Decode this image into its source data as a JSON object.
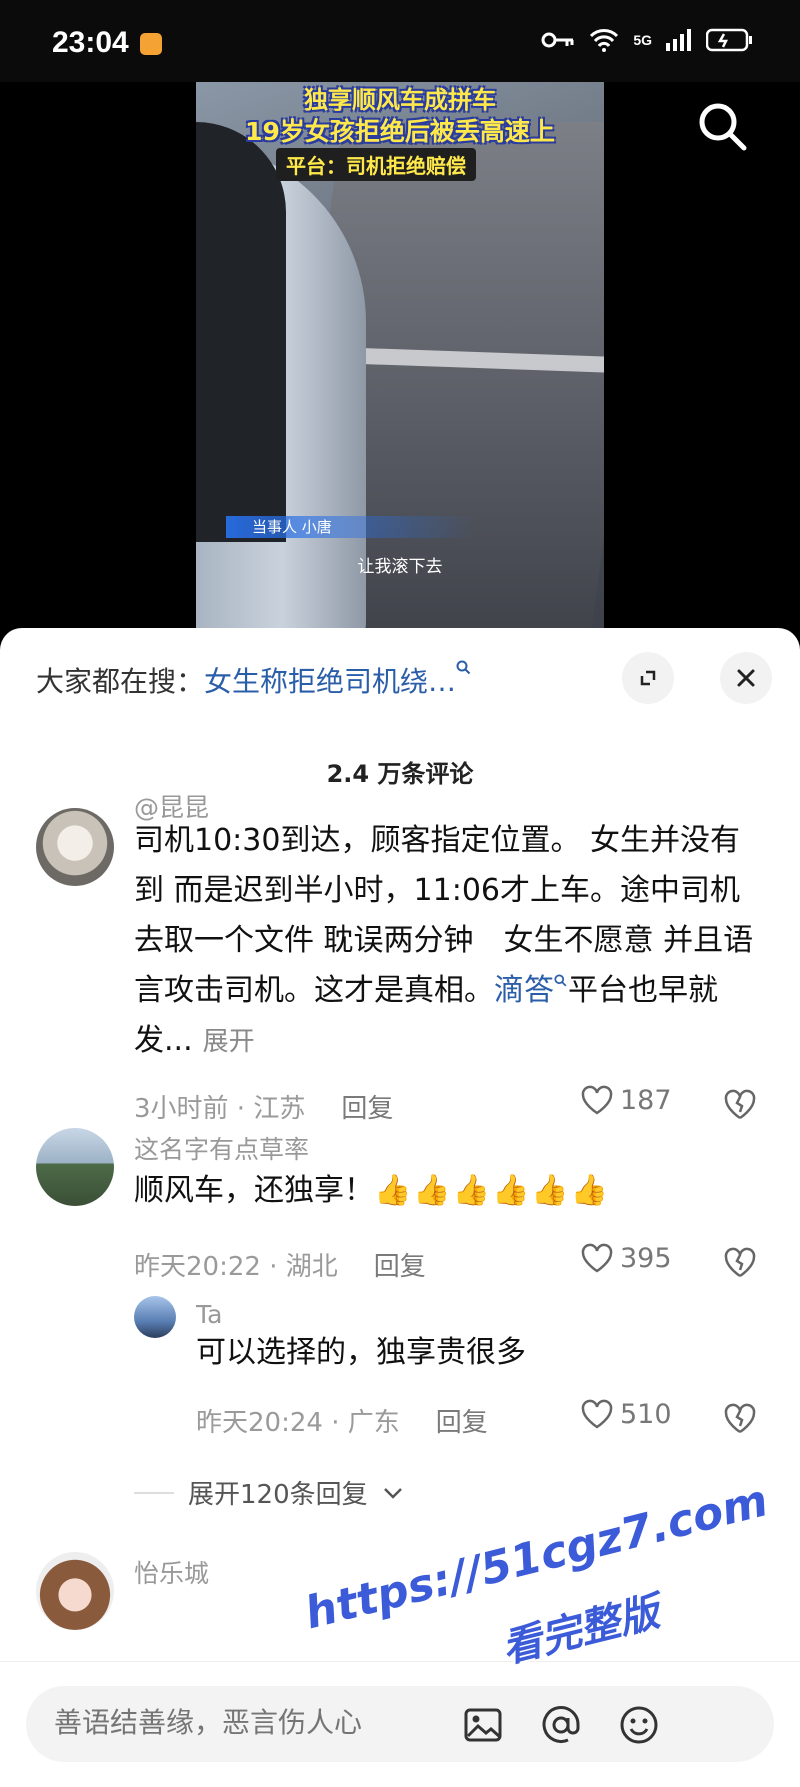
{
  "status_bar": {
    "time": "23:04",
    "network": "5G"
  },
  "video": {
    "caption_line1": "独享顺风车成拼车",
    "caption_line2": "19岁女孩拒绝后被丢高速上",
    "caption_line3": "平台：司机拒绝赔偿",
    "name_tag": "当事人 小唐",
    "subtitle": "让我滚下去"
  },
  "panel": {
    "hot_search_prefix": "大家都在搜：",
    "hot_search_query": "女生称拒绝司机绕…",
    "comment_count": "2.4 万条评论"
  },
  "comments": [
    {
      "username": "@昆昆",
      "text": "司机10:30到达，顾客指定位置。 女生并没有到 而是迟到半小时，11:06才上车。途中司机去取一个文件 耽误两分钟　女生不愿意 并且语言攻击司机。这才是真相。",
      "link_text": "滴答",
      "tail_text": "平台也早就发...",
      "expand_label": "展开",
      "time": "3小时前 · 江苏",
      "reply_label": "回复",
      "likes": "187"
    },
    {
      "username": "这名字有点草率",
      "text": "顺风车，还独享！",
      "emoji": "👍👍👍👍👍👍",
      "time": "昨天20:22 · 湖北",
      "reply_label": "回复",
      "likes": "395"
    },
    {
      "username": "Ta",
      "text": "可以选择的，独享贵很多",
      "time": "昨天20:24 · 广东",
      "reply_label": "回复",
      "likes": "510"
    },
    {
      "username": "怡乐城"
    }
  ],
  "expand_replies": "展开120条回复",
  "input": {
    "placeholder": "善语结善缘，恶言伤人心"
  },
  "watermark": {
    "line1": "https://51cgz7.com",
    "line2": "看完整版"
  }
}
